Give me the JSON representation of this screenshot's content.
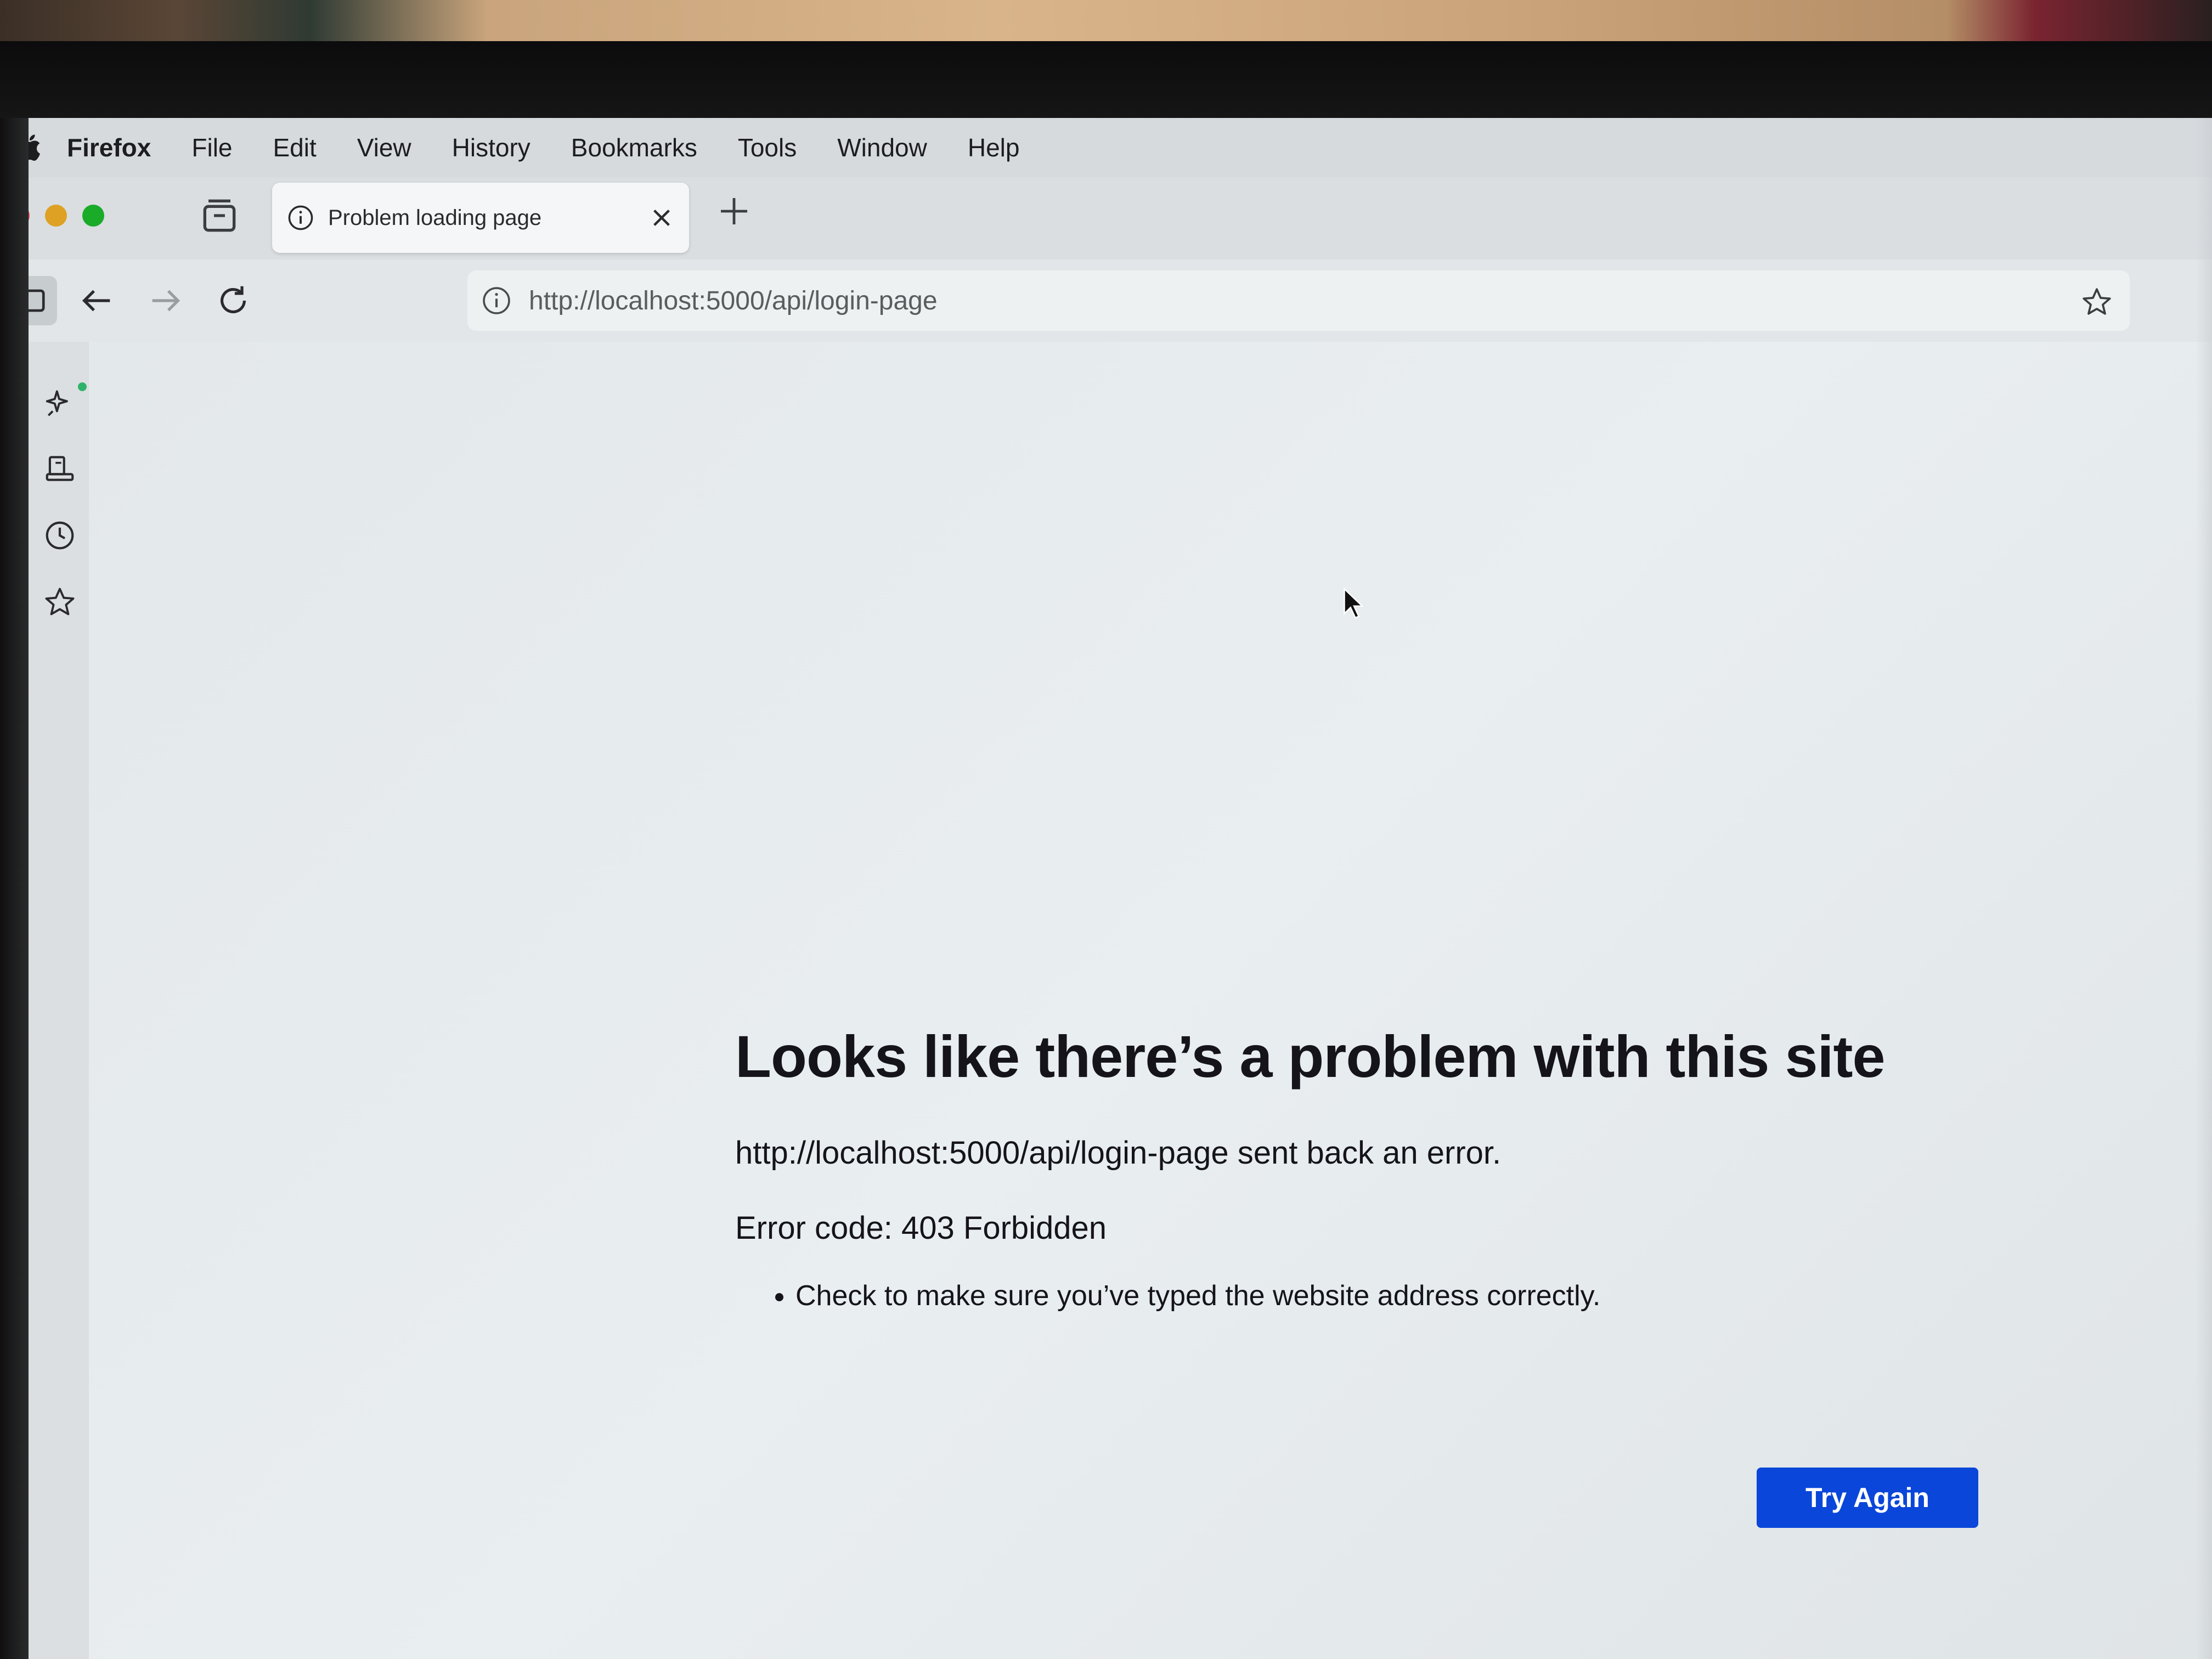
{
  "menubar": {
    "app": "Firefox",
    "items": [
      "File",
      "Edit",
      "View",
      "History",
      "Bookmarks",
      "Tools",
      "Window",
      "Help"
    ]
  },
  "tab": {
    "title": "Problem loading page"
  },
  "navbar": {
    "url": "http://localhost:5000/api/login-page"
  },
  "error": {
    "title": "Looks like there’s a problem with this site",
    "description": "http://localhost:5000/api/login-page sent back an error.",
    "code": "Error code: 403 Forbidden",
    "tips": [
      "Check to make sure you’ve typed the website address correctly."
    ],
    "button": "Try Again"
  },
  "icons": {
    "menubar": "apple-logo-icon",
    "tabstrip": [
      "tab-list-icon",
      "info-icon",
      "close-icon",
      "plus-icon"
    ],
    "navbar": [
      "sidebar-icon",
      "back-arrow-icon",
      "forward-arrow-icon",
      "reload-icon",
      "info-icon",
      "star-icon"
    ],
    "sidebar": [
      "sparkle-icon",
      "synced-tabs-icon",
      "history-clock-icon",
      "bookmarks-star-icon"
    ]
  },
  "colors": {
    "accent_button": "#0a46d9",
    "close_dot": "#e0443e",
    "minimize_dot": "#dea123",
    "zoom_dot": "#1aab29",
    "page_background": "#e6ebed"
  }
}
